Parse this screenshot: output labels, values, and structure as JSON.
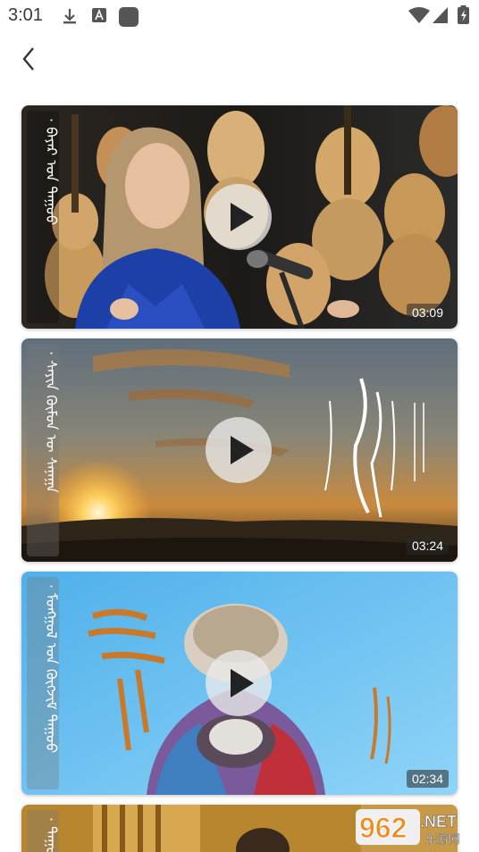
{
  "status_bar": {
    "time": "3:01"
  },
  "videos": [
    {
      "title": "· ᠪᠠᠶᠠᠷ ᠤᠨ ᠳᠠᠭᠤᠤ",
      "duration": "03:09"
    },
    {
      "title": "· ᠰᠠᠶᠢᠨ ᠬᠦᠮᠦᠨ ᠦ ᠰᠠᠨᠠᠭᠠ",
      "duration": "03:24"
    },
    {
      "title": "· ᠮᠣᠩᠭᠣᠯ ᠤᠨ ᠬᠥᠭᠵᠢᠮ ᠳᠠᠭᠤᠤ",
      "duration": "02:34"
    },
    {
      "title": "· ᠳᠠᠭᠤᠤ",
      "duration": ""
    }
  ],
  "watermark": {
    "number": "962",
    "suffix": ".NET",
    "subtitle": "乐游网"
  }
}
